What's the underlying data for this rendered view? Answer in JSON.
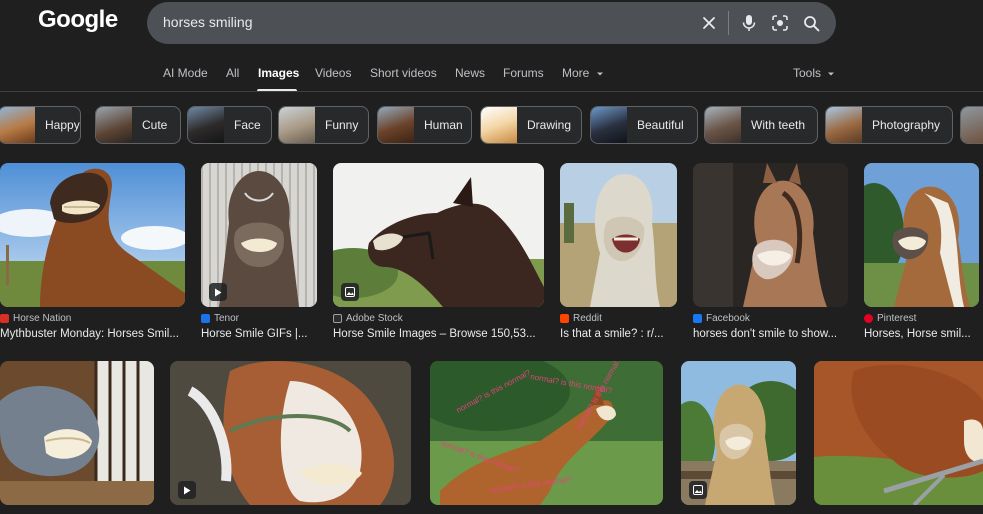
{
  "header": {
    "logo": "Google",
    "search_value": "horses smiling"
  },
  "tabs": [
    {
      "label": "AI Mode"
    },
    {
      "label": "All"
    },
    {
      "label": "Images",
      "active": true
    },
    {
      "label": "Videos"
    },
    {
      "label": "Short videos"
    },
    {
      "label": "News"
    },
    {
      "label": "Forums"
    },
    {
      "label": "More"
    }
  ],
  "tools_label": "Tools",
  "chips": [
    {
      "label": "Happy"
    },
    {
      "label": "Cute"
    },
    {
      "label": "Face"
    },
    {
      "label": "Funny"
    },
    {
      "label": "Human"
    },
    {
      "label": "Drawing"
    },
    {
      "label": "Beautiful"
    },
    {
      "label": "With teeth"
    },
    {
      "label": "Photography"
    }
  ],
  "results_row1": [
    {
      "source": "Horse Nation",
      "title": "Mythbuster Monday: Horses Smil..."
    },
    {
      "source": "Tenor",
      "title": "Horse Smile GIFs |..."
    },
    {
      "source": "Adobe Stock",
      "title": "Horse Smile Images – Browse 150,53..."
    },
    {
      "source": "Reddit",
      "title": "Is that a smile? : r/..."
    },
    {
      "source": "Facebook",
      "title": "horses don't smile to show..."
    },
    {
      "source": "Pinterest",
      "title": "Horses, Horse smil..."
    }
  ],
  "overlay_text": "normal? is this normal?",
  "colors": {
    "background": "#1f1f1f",
    "search_box": "#4d5156",
    "chip_border": "#5f6368",
    "text_primary": "#e8eaed",
    "text_secondary": "#bdc1c6"
  }
}
